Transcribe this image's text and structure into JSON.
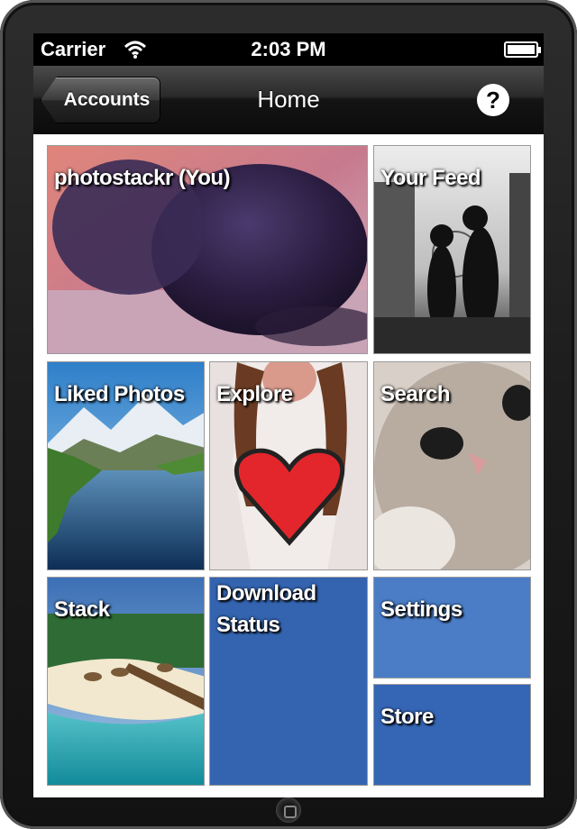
{
  "status_bar": {
    "carrier": "Carrier",
    "time": "2:03 PM"
  },
  "nav": {
    "back_label": "Accounts",
    "title": "Home",
    "help_label": "?"
  },
  "tiles": {
    "profile": "photostackr (You)",
    "feed": "Your Feed",
    "liked": "Liked Photos",
    "explore": "Explore",
    "search": "Search",
    "stack": "Stack",
    "download": "Download Status",
    "settings": "Settings",
    "store": "Store"
  },
  "colors": {
    "tile_blue": "#3464b0",
    "tile_blue_light": "#4a7dc6"
  }
}
